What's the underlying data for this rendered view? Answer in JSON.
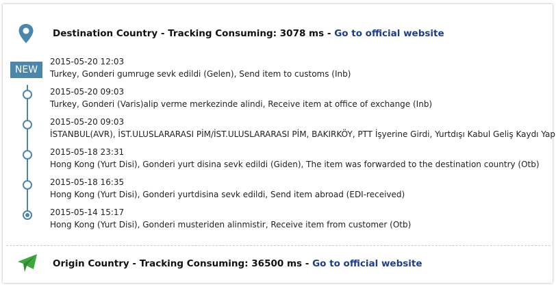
{
  "destination": {
    "title": "Destination Country",
    "separator": " - ",
    "consuming": "Tracking Consuming: 3078 ms",
    "separator2": " - ",
    "link": "Go to official website"
  },
  "badge": "NEW",
  "events": [
    {
      "date": "2015-05-20 12:03",
      "desc": "Turkey, Gonderi gumruge sevk edildi (Gelen), Send item to customs (Inb)"
    },
    {
      "date": "2015-05-20 09:03",
      "desc": "Turkey, Gonderi (Varis)alip verme merkezinde alindi, Receive item at office of exchange (Inb)"
    },
    {
      "date": "2015-05-20 09:03",
      "desc": "İSTANBUL(AVR), İST.ULUSLARARASI PİM/İST.ULUSLARARASI PİM, BAKIRKÖY, PTT İşyerine Girdi, Yurtdışı Kabul Geliş Kaydı Yapıldı"
    },
    {
      "date": "2015-05-18 23:31",
      "desc": "Hong Kong (Yurt Disi), Gonderi yurt disina sevk edildi (Giden), The item was forwarded to the destination country (Otb)"
    },
    {
      "date": "2015-05-18 16:35",
      "desc": "Hong Kong (Yurt Disi), Gonderi yurtdisina sevk edildi, Send item abroad (EDI-received)"
    },
    {
      "date": "2015-05-14 15:17",
      "desc": "Hong Kong (Yurt Disi), Gonderi musteriden alinmistir, Receive item from customer (Otb)"
    }
  ],
  "origin": {
    "title": "Origin Country",
    "separator": " - ",
    "consuming": "Tracking Consuming: 36500 ms",
    "separator2": " - ",
    "link": "Go to official website"
  },
  "icons": {
    "destination": "map-pin-icon",
    "origin": "paper-plane-icon"
  },
  "colors": {
    "accent": "#4a87aa",
    "link": "#1e3d8f",
    "plane": "#3aa83a"
  }
}
